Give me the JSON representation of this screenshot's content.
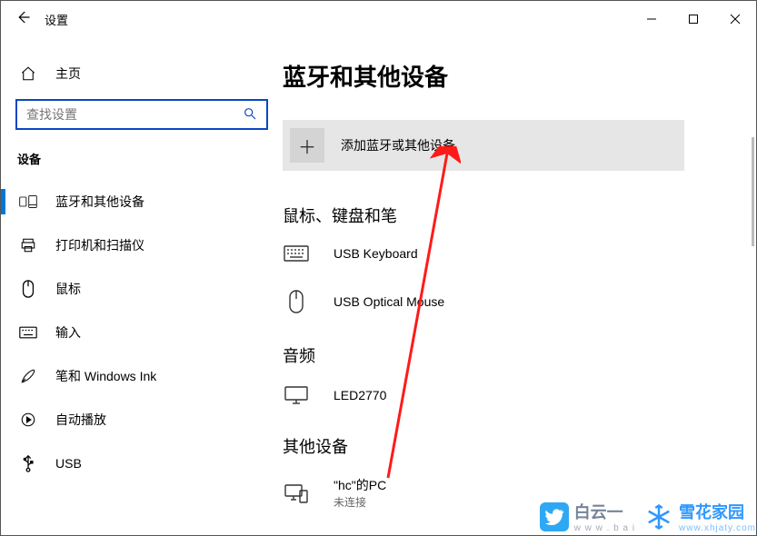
{
  "window": {
    "title": "设置"
  },
  "sidebar": {
    "home_label": "主页",
    "search_placeholder": "查找设置",
    "category": "设备",
    "items": [
      {
        "label": "蓝牙和其他设备"
      },
      {
        "label": "打印机和扫描仪"
      },
      {
        "label": "鼠标"
      },
      {
        "label": "输入"
      },
      {
        "label": "笔和 Windows Ink"
      },
      {
        "label": "自动播放"
      },
      {
        "label": "USB"
      }
    ]
  },
  "content": {
    "title": "蓝牙和其他设备",
    "add_label": "添加蓝牙或其他设备",
    "sections": {
      "mouse_kb_pen": "鼠标、键盘和笔",
      "audio": "音频",
      "other": "其他设备"
    },
    "devices": {
      "keyboard": "USB Keyboard",
      "mouse": "USB Optical Mouse",
      "monitor": "LED2770",
      "pc_name": "\"hc\"的PC",
      "pc_status": "未连接"
    }
  },
  "watermarks": {
    "wm1_text": "白云一",
    "wm1_sub": "w w w . b a i",
    "wm2_text": "雪花家园",
    "wm2_sub": "www.xhjaty.com"
  }
}
